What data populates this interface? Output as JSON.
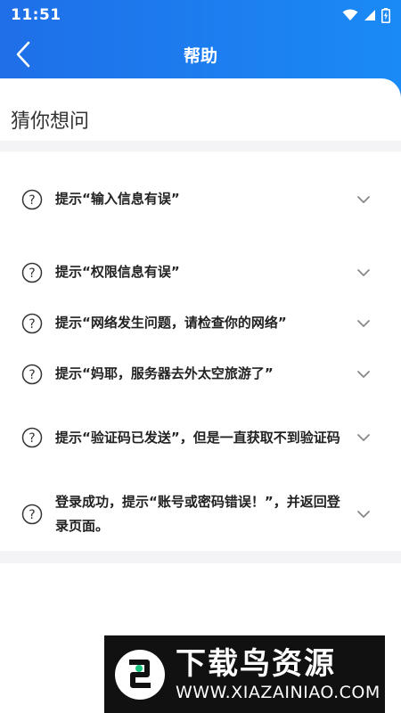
{
  "status_bar": {
    "time": "11:51"
  },
  "header": {
    "title": "帮助"
  },
  "section": {
    "title": "猜你想问"
  },
  "faq": [
    {
      "text": "提示“输入信息有误”"
    },
    {
      "text": "提示“权限信息有误”"
    },
    {
      "text": "提示“网络发生问题，请检查你的网络”"
    },
    {
      "text": "提示“妈耶，服务器去外太空旅游了”"
    },
    {
      "text": "提示“验证码已发送”，但是一直获取不到验证码"
    },
    {
      "text": "登录成功，提示“账号或密码错误！”，并返回登录页面。"
    }
  ],
  "watermark": {
    "brand": "下载鸟资源",
    "url": "WWW.XIAZAINIAO.COM"
  },
  "colors": {
    "header_start": "#1f6fe8",
    "header_end": "#1a8af6",
    "divider": "#f4f4f6"
  }
}
